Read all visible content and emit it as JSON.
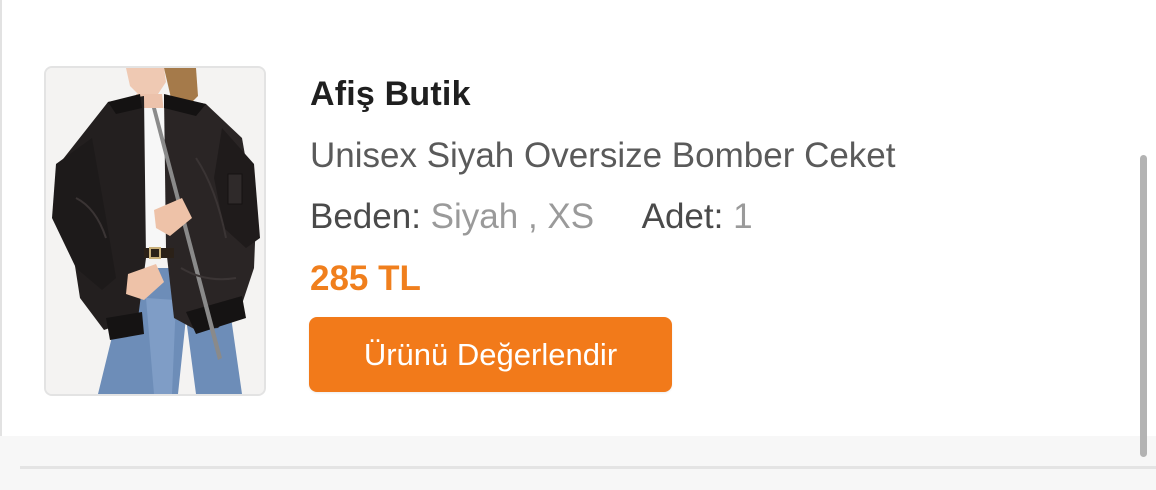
{
  "order_item": {
    "image_alt": "Unisex Siyah Oversize Bomber Ceket",
    "store_name": "Afiş Butik",
    "product_title": "Unisex Siyah Oversize Bomber Ceket",
    "size_label": "Beden:",
    "size_value": "Siyah , XS",
    "quantity_label": "Adet:",
    "quantity_value": "1",
    "price": "285 TL",
    "review_button_label": "Ürünü Değerlendir"
  },
  "colors": {
    "accent": "#f27a1a",
    "price": "#f07f1d",
    "background": "#ffffff"
  }
}
